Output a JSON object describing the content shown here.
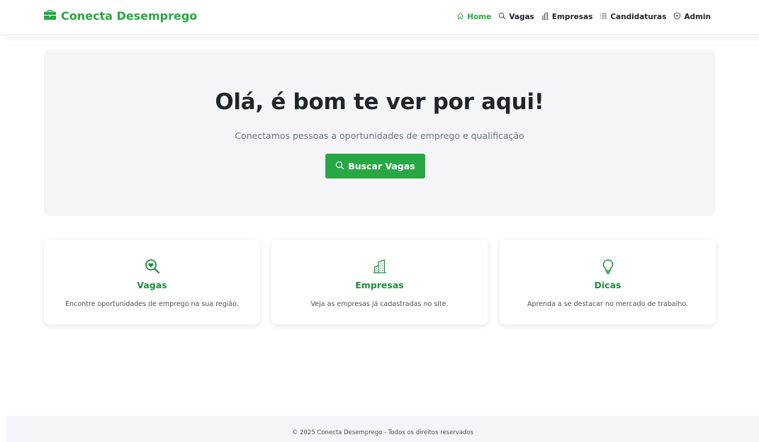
{
  "brand": {
    "name": "Conecta Desemprego",
    "icon": "briefcase-icon"
  },
  "nav": {
    "items": [
      {
        "label": "Home",
        "icon": "home-icon",
        "active": true
      },
      {
        "label": "Vagas",
        "icon": "search-icon",
        "active": false
      },
      {
        "label": "Empresas",
        "icon": "buildings-icon",
        "active": false
      },
      {
        "label": "Candidaturas",
        "icon": "list-icon",
        "active": false
      },
      {
        "label": "Admin",
        "icon": "shield-icon",
        "active": false
      }
    ]
  },
  "hero": {
    "title": "Olá, é bom te ver por aqui!",
    "subtitle": "Conectamos pessoas a oportunidades de emprego e qualificação",
    "button_label": "Buscar Vagas",
    "button_icon": "search-icon"
  },
  "cards": [
    {
      "title": "Vagas",
      "description": "Encontre oportunidades de emprego na sua região.",
      "icon": "search-heart-icon"
    },
    {
      "title": "Empresas",
      "description": "Veja as empresas já cadastradas no site.",
      "icon": "buildings-icon"
    },
    {
      "title": "Dicas",
      "description": "Aprenda a se destacar no mercado de trabalho.",
      "icon": "lightbulb-icon"
    }
  ],
  "footer": {
    "text": "© 2025 Conecta Desemprego - Todos os direitos reservados"
  },
  "colors": {
    "accent": "#28a745",
    "card_title": "#1e8e3e",
    "hero_bg": "#f5f5f8"
  }
}
